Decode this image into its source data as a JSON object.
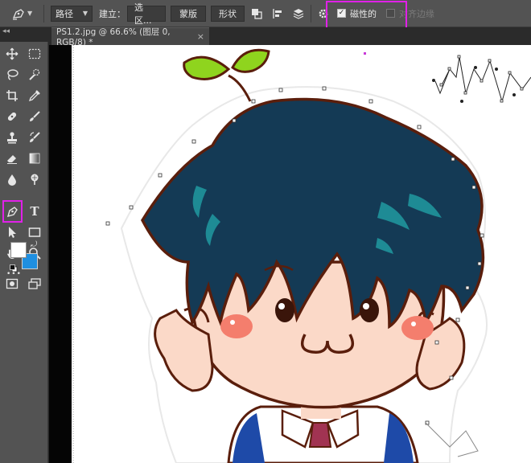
{
  "options_bar": {
    "mode_value": "路径",
    "make_label": "建立：",
    "selection_button": "选区...",
    "mask_button": "蒙版",
    "shape_button": "形状",
    "magnetic_label": "磁性的",
    "magnetic_checked": true,
    "align_edges_label": "对齐边缘",
    "align_edges_checked": false
  },
  "document": {
    "tab_title": "PS1.2.jpg @ 66.6% (图层 0, RGB/8) *",
    "close_glyph": "×"
  },
  "toolbar": {
    "type_tool_glyph": "T",
    "more_glyph": "•••"
  },
  "colors": {
    "highlight": "#e021e8",
    "foreground": "#ffffff",
    "background": "#1f8fe0",
    "hair": "#143a55",
    "hair_streak": "#1e8b95",
    "skin": "#fbd9c8",
    "outline": "#5a1e0c",
    "leaf": "#8fd41e",
    "blush": "#f47e6d"
  }
}
